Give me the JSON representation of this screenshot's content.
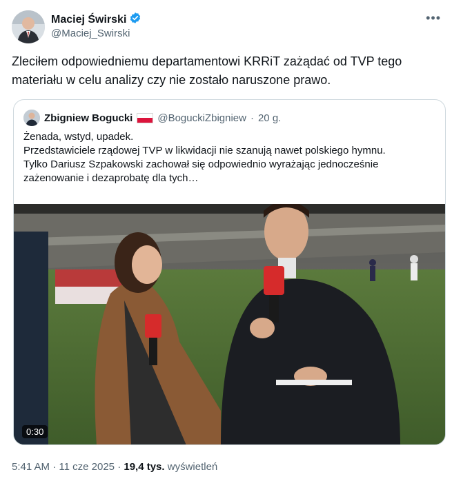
{
  "author": {
    "name": "Maciej Świrski",
    "handle": "@Maciej_Swirski",
    "verified": true,
    "verified_color": "#1d9bf0"
  },
  "tweet": {
    "text": "Zleciłem odpowiedniemu departamentowi KRRiT zażądać od TVP tego materiału w celu analizy czy nie zostało naruszone prawo."
  },
  "quote": {
    "name": "Zbigniew Bogucki",
    "handle": "@BoguckiZbigniew",
    "separator": "·",
    "time": "20 g.",
    "text": "Żenada, wstyd, upadek.\nPrzedstawiciele rządowej TVP w likwidacji nie szanują nawet polskiego hymnu.\nTylko Dariusz Szpakowski zachował się odpowiednio wyrażając jednocześnie zażenowanie i dezaprobatę dla tych…",
    "video_duration": "0:30"
  },
  "footer": {
    "time": "5:41 AM",
    "separator": "·",
    "date": "11 cze 2025",
    "views": "19,4 tys.",
    "views_label": "wyświetleń"
  },
  "more_icon": "more-dots-icon"
}
